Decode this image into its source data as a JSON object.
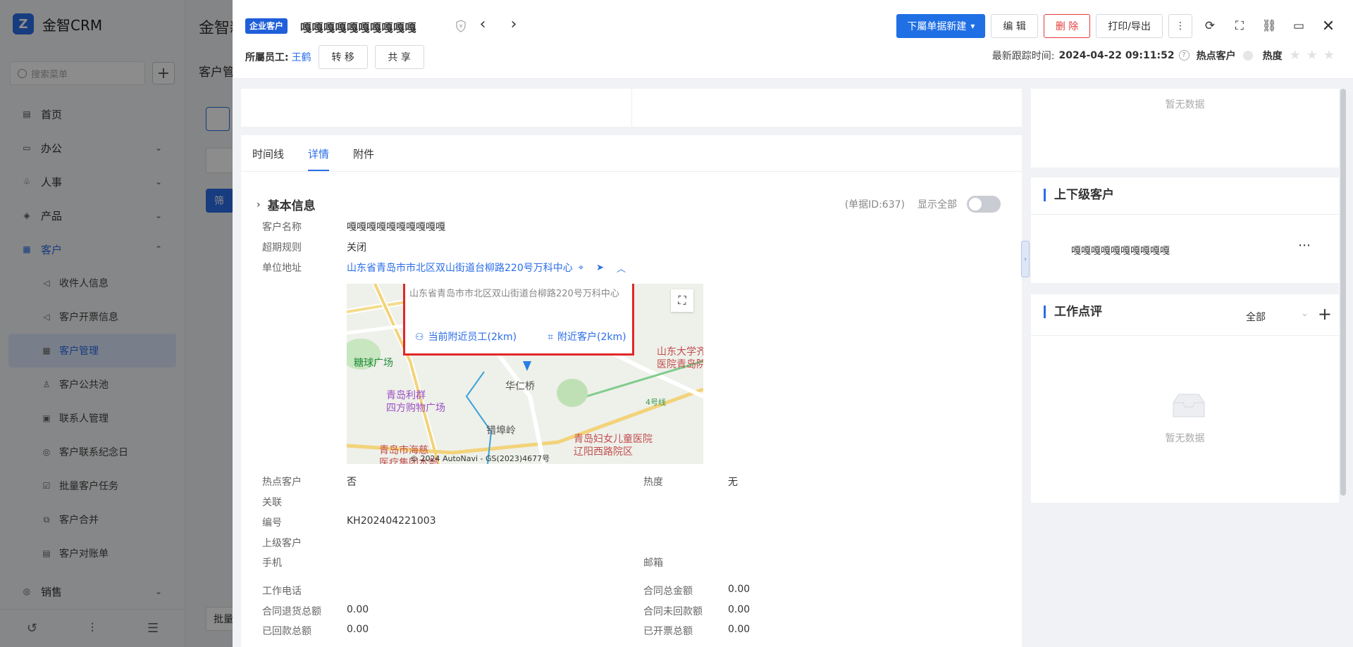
{
  "background": {
    "logo_mark": "Z",
    "logo_text": "金智CRM",
    "search_placeholder": "搜索菜单",
    "page_title": "金智新",
    "page_subtitle": "客户管",
    "filter_label": "筛",
    "bulk_label": "批量",
    "menu": [
      {
        "label": "首页",
        "icon": "home-icon",
        "glyph": "▤",
        "chev": ""
      },
      {
        "label": "办公",
        "icon": "office-icon",
        "glyph": "▭",
        "chev": "⌄"
      },
      {
        "label": "人事",
        "icon": "hr-icon",
        "glyph": "♧",
        "chev": "⌄"
      },
      {
        "label": "产品",
        "icon": "product-icon",
        "glyph": "◈",
        "chev": "⌄"
      },
      {
        "label": "客户",
        "icon": "customer-icon",
        "glyph": "▦",
        "chev": "⌃"
      }
    ],
    "submenu": [
      {
        "label": "收件人信息",
        "icon": "recipient-icon",
        "glyph": "◁"
      },
      {
        "label": "客户开票信息",
        "icon": "invoice-icon",
        "glyph": "◁"
      },
      {
        "label": "客户管理",
        "icon": "customer-manage-icon",
        "glyph": "▦"
      },
      {
        "label": "客户公共池",
        "icon": "public-pool-icon",
        "glyph": "♙"
      },
      {
        "label": "联系人管理",
        "icon": "contact-icon",
        "glyph": "▣"
      },
      {
        "label": "客户联系纪念日",
        "icon": "anniversary-icon",
        "glyph": "◎"
      },
      {
        "label": "批量客户任务",
        "icon": "batch-task-icon",
        "glyph": "☑"
      },
      {
        "label": "客户合并",
        "icon": "merge-icon",
        "glyph": "⧉"
      },
      {
        "label": "客户对账单",
        "icon": "statement-icon",
        "glyph": "▤"
      }
    ],
    "sales": {
      "label": "销售",
      "icon": "sales-icon",
      "glyph": "◎",
      "chev": "⌄"
    }
  },
  "header": {
    "tag": "企业客户",
    "customer_name": "嘎嘎嘎嘎嘎嘎嘎嘎嘎嘎",
    "owner_label": "所屬员工:",
    "owner_name": "王鹤",
    "transfer": "转 移",
    "share": "共 享",
    "new_dropdown": "下屬单据新建",
    "edit": "编 辑",
    "delete": "删 除",
    "print": "打印/导出",
    "last_follow_label": "最新跟踪时间:",
    "last_follow_time": "2024-04-22 09:11:52",
    "hot_label": "热点客户",
    "heat_label": "热度",
    "stars": "★★★"
  },
  "tabs": [
    "时间线",
    "详情",
    "附件"
  ],
  "active_tab": 1,
  "basic": {
    "title": "基本信息",
    "doc_id": "(单据ID:637)",
    "show_all": "显示全部",
    "customer_name_label": "客户名称",
    "customer_name": "嘎嘎嘎嘎嘎嘎嘎嘎嘎嘎",
    "overdue_label": "超期规则",
    "overdue": "关闭",
    "address_label": "单位地址",
    "address": "山东省青岛市市北区双山街道台柳路220号万科中心",
    "hot_label": "热点客户",
    "hot": "否",
    "heat_label": "热度",
    "heat": "无",
    "related_label": "关联",
    "code_label": "编号",
    "code": "KH202404221003",
    "parent_label": "上级客户",
    "mobile_label": "手机",
    "email_label": "邮箱",
    "work_phone_label": "工作电话",
    "contract_total_label": "合同总金额",
    "contract_total": "0.00",
    "refund_total_label": "合同退货总额",
    "refund_total": "0.00",
    "unreceived_label": "合同未回款额",
    "unreceived": "0.00",
    "received_label": "已回款总额",
    "received": "0.00",
    "invoiced_label": "已开票总额",
    "invoiced": "0.00"
  },
  "map": {
    "popup_address": "山东省青岛市市北区双山街道台柳路220号万科中心",
    "nearby_staff": "当前附近员工(2km)",
    "nearby_customers": "附近客户(2km)",
    "labels": {
      "sugar": "糖球广场",
      "lijun": "青岛利群\n四方购物广场",
      "huaren": "华仁桥",
      "cuo": "错埠岭",
      "hospital_haici": "青岛市海慈\n医疗集团本部",
      "fuer": "青岛妇女儿童医院\n辽阳西路院区",
      "sdu": "山东大学齐\n医院青岛院",
      "line4": "4号线"
    },
    "copyright": "© 2024 AutoNavi - GS(2023)4677号"
  },
  "right": {
    "no_data": "暂无数据",
    "hierarchy_title": "上下级客户",
    "hierarchy_item": "嘎嘎嘎嘎嘎嘎嘎嘎嘎嘎",
    "review_title": "工作点评",
    "review_filter": "全部",
    "review_no_data": "暂无数据"
  }
}
